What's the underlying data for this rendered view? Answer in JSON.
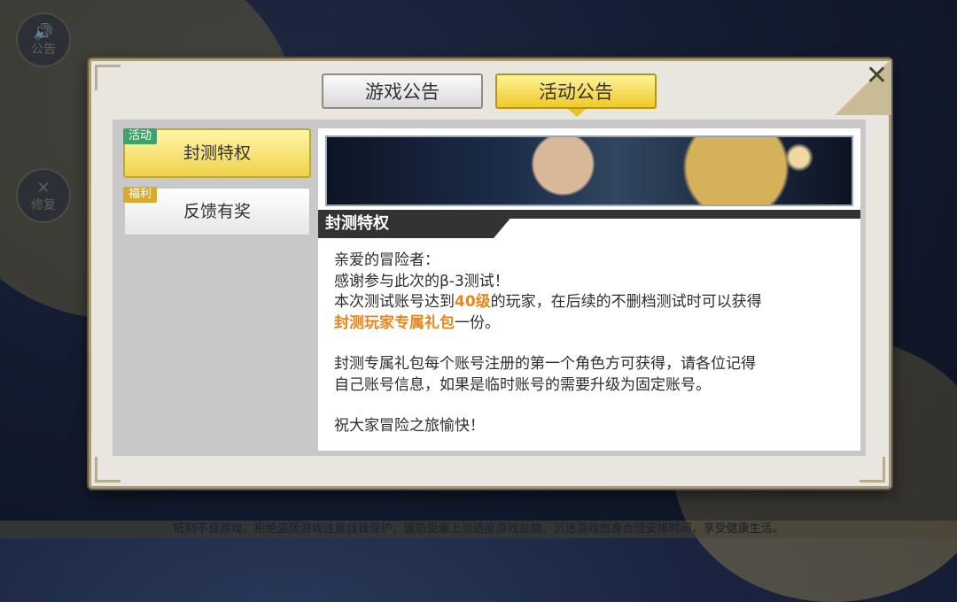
{
  "side_buttons": {
    "notice_label": "公告",
    "fix_label": "修复"
  },
  "footer": "抵制不良游戏，拒绝盗版游戏注意自我保护，谨防受骗上当适度游戏益脑，沉迷游戏伤身合理安排时间，享受健康生活。",
  "tabs": {
    "game_notice": "游戏公告",
    "event_notice": "活动公告"
  },
  "list": [
    {
      "tag": "活动",
      "label": "封测特权",
      "active": true
    },
    {
      "tag": "福利",
      "label": "反馈有奖",
      "active": false
    }
  ],
  "content": {
    "title": "封测特权",
    "line1": "亲爱的冒险者：",
    "line2": "感谢参与此次的β-3测试！",
    "line3_a": "本次测试账号达到",
    "line3_hl": "40级",
    "line3_b": "的玩家，在后续的不删档测试时可以获得",
    "line4_hl": "封测玩家专属礼包",
    "line4_b": "一份。",
    "line5": "封测专属礼包每个账号注册的第一个角色方可获得，请各位记得",
    "line6": "自己账号信息，如果是临时账号的需要升级为固定账号。",
    "line7": "祝大家冒险之旅愉快！"
  },
  "colors": {
    "accent_yellow": "#f0c929",
    "highlight_orange": "#e7861c",
    "tag_green": "#3fa26a"
  }
}
